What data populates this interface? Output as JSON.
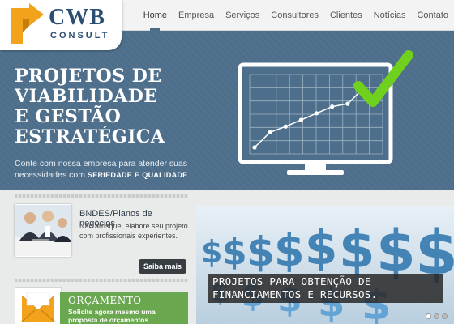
{
  "logo": {
    "name": "CWB",
    "tagline": "CONSULT"
  },
  "nav": [
    {
      "label": "Home",
      "active": true
    },
    {
      "label": "Empresa"
    },
    {
      "label": "Serviços"
    },
    {
      "label": "Consultores"
    },
    {
      "label": "Clientes"
    },
    {
      "label": "Notícias"
    },
    {
      "label": "Contato"
    }
  ],
  "hero": {
    "title_lines": [
      "PROJETOS DE",
      "VIABILIDADE",
      "E GESTÃO",
      "ESTRATÉGICA"
    ],
    "subtitle_prefix": "Conte com nossa empresa para atender suas necessidades com",
    "subtitle_strong1": "SERIEDADE",
    "subtitle_connector": "E",
    "subtitle_strong2": "QUALIDADE",
    "chart_points": [
      [
        0,
        0
      ],
      [
        1,
        1.6
      ],
      [
        2,
        2.2
      ],
      [
        3,
        2.9
      ],
      [
        4,
        3.6
      ],
      [
        5,
        4.3
      ],
      [
        6,
        4.6
      ],
      [
        7,
        6.2
      ]
    ]
  },
  "card_bndes": {
    "title": "BNDES/Planos de negócios",
    "text": "Não arrisque, elabore seu projeto com profissionais experientes.",
    "button": "Saiba mais"
  },
  "card_orcamento": {
    "title": "ORÇAMENTO",
    "text": "Solicite agora mesmo uma proposta de orçamentos"
  },
  "banner": {
    "caption_line1": "PROJETOS PARA OBTENÇÃO DE",
    "caption_line2": "FINANCIAMENTOS E RECURSOS."
  },
  "colors": {
    "brand_blue": "#2a4f73",
    "brand_orange": "#f3a21c",
    "hero_bg": "#4e6f8b",
    "check_green": "#6fd11d",
    "orcamento_green": "#6aa84f"
  }
}
